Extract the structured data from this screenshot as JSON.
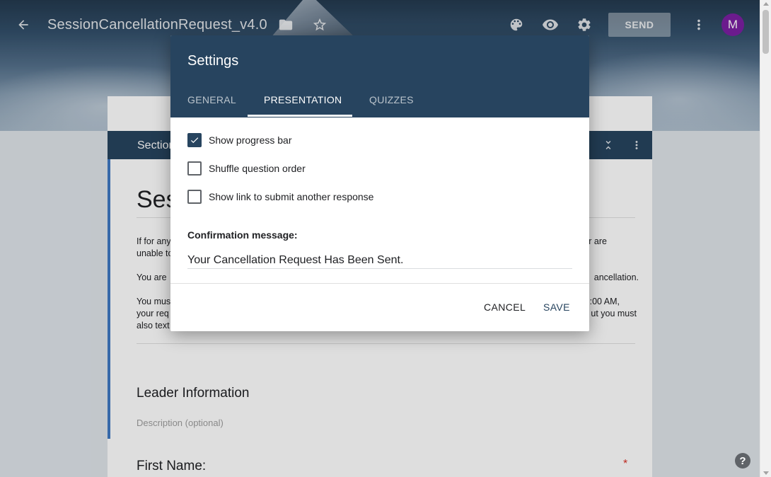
{
  "header": {
    "title": "SessionCancellationRequest_v4.0",
    "send_label": "SEND",
    "avatar_letter": "M"
  },
  "form": {
    "section_label": "Section",
    "title_visible": "Ses",
    "description_lines": [
      {
        "left": "If for any",
        "right": "r are"
      },
      {
        "left": "unable to",
        "right": ""
      },
      {
        "left": "You are",
        "right": "ancellation."
      },
      {
        "left": "You must",
        "right": ":00 AM,"
      },
      {
        "left": "your req",
        "right": "ut you must"
      },
      {
        "left": "also text",
        "right": ""
      }
    ],
    "question_title": "Leader Information",
    "question_desc_placeholder": "Description (optional)",
    "question2_title": "First Name:",
    "required_mark": "*"
  },
  "dialog": {
    "title": "Settings",
    "tabs": [
      {
        "label": "GENERAL",
        "active": false
      },
      {
        "label": "PRESENTATION",
        "active": true
      },
      {
        "label": "QUIZZES",
        "active": false
      }
    ],
    "options": [
      {
        "label": "Show progress bar",
        "checked": true
      },
      {
        "label": "Shuffle question order",
        "checked": false
      },
      {
        "label": "Show link to submit another response",
        "checked": false
      }
    ],
    "confirmation_label": "Confirmation message:",
    "confirmation_value": "Your Cancellation Request Has Been Sent.",
    "cancel_label": "CANCEL",
    "save_label": "SAVE"
  },
  "help_label": "?",
  "colors": {
    "theme": "#27445f",
    "accent_edge": "#3f79c3",
    "avatar": "#7b1fa2"
  }
}
